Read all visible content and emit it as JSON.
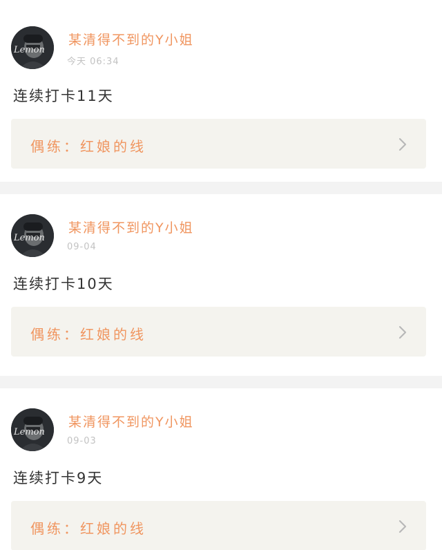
{
  "posts": [
    {
      "username": "某清得不到的Y小姐",
      "timestamp": "今天 06:34",
      "content": "连续打卡11天",
      "practice": "偶练：红娘的线",
      "avatar_text": "Lemon"
    },
    {
      "username": "某清得不到的Y小姐",
      "timestamp": "09-04",
      "content": "连续打卡10天",
      "practice": "偶练：红娘的线",
      "avatar_text": "Lemon"
    },
    {
      "username": "某清得不到的Y小姐",
      "timestamp": "09-03",
      "content": "连续打卡9天",
      "practice": "偶练：红娘的线",
      "avatar_text": "Lemon"
    }
  ],
  "icons": {
    "card_arrow": "chevron-right-icon"
  },
  "colors": {
    "accent": "#f0955f",
    "timestamp": "#c2c2c2",
    "card_bg": "#f4f3ee",
    "separator": "#f3f3f3",
    "top_indicator": "#ff6b9a"
  }
}
